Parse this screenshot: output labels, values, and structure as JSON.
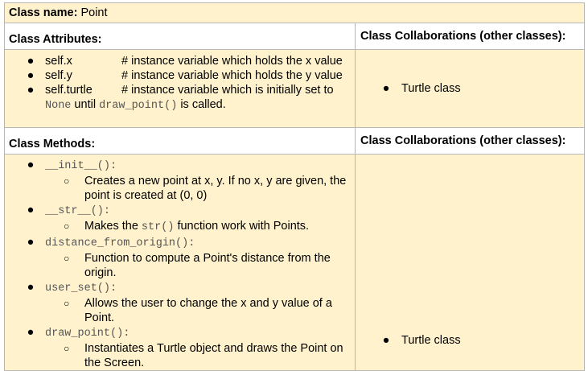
{
  "class_name": {
    "label": "Class name:",
    "value": "Point"
  },
  "attributes_header": "Class Attributes:",
  "collaborations_header": "Class Collaborations (other classes):",
  "attributes": [
    {
      "name": "self.x",
      "desc": "# instance variable which holds the x value"
    },
    {
      "name": "self.y",
      "desc": "# instance variable which holds the y value"
    },
    {
      "name": "self.turtle",
      "desc": "# instance variable which is initially set to",
      "cont_code1": "None",
      "cont_text1": " until ",
      "cont_code2": "draw_point()",
      "cont_text2": " is called."
    }
  ],
  "attribute_collaborations": [
    "Turtle class"
  ],
  "methods_header": "Class Methods:",
  "methods": [
    {
      "name": "__init__():",
      "desc_a": "Creates a new point at x, y. If no x, y are given, the",
      "desc_b": "point is created at (0, 0)"
    },
    {
      "name": "__str__():",
      "desc_a": "Makes the ",
      "desc_code": "str()",
      "desc_a2": " function work with Points."
    },
    {
      "name": "distance_from_origin():",
      "desc_a": "Function to compute a Point's distance from the",
      "desc_b": "origin."
    },
    {
      "name": "user_set():",
      "desc_a": "Allows the user to change the x and y value of a",
      "desc_b": "Point."
    },
    {
      "name": "draw_point():",
      "desc_a": "Instantiates a Turtle object and draws the Point on",
      "desc_b": "the Screen."
    }
  ],
  "method_collaborations": [
    "Turtle class"
  ],
  "symbols": {
    "bullet": "●",
    "sub_bullet": "○"
  }
}
